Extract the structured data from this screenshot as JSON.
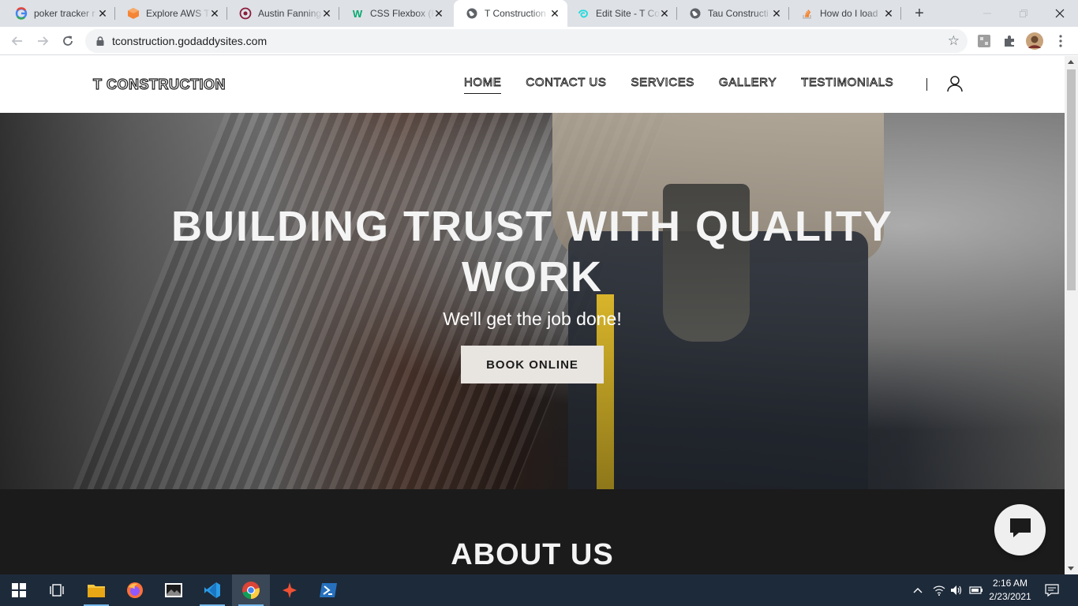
{
  "browser": {
    "tabs": [
      {
        "title": "poker tracker r",
        "icon": "google-icon",
        "active": false
      },
      {
        "title": "Explore AWS T",
        "icon": "aws-icon",
        "active": false
      },
      {
        "title": "Austin Fanning",
        "icon": "austin-site-icon",
        "active": false
      },
      {
        "title": "CSS Flexbox (F",
        "icon": "w3schools-icon",
        "active": false
      },
      {
        "title": "T Construction",
        "icon": "globe-icon",
        "active": true
      },
      {
        "title": "Edit Site - T Co",
        "icon": "godaddy-icon",
        "active": false
      },
      {
        "title": "Tau Constructi",
        "icon": "globe-icon",
        "active": false
      },
      {
        "title": "How do I load",
        "icon": "stackoverflow-icon",
        "active": false
      }
    ],
    "new_tab_label": "+",
    "url": "tconstruction.godaddysites.com"
  },
  "site": {
    "logo": "T CONSTRUCTION",
    "nav": [
      "HOME",
      "CONTACT US",
      "SERVICES",
      "GALLERY",
      "TESTIMONIALS"
    ],
    "current_nav": "HOME",
    "hero": {
      "title_line1": "BUILDING TRUST WITH QUALITY",
      "title_line2": "WORK",
      "subtitle": "We'll get the job done!",
      "cta": "BOOK ONLINE"
    },
    "about_title": "ABOUT US"
  },
  "taskbar": {
    "apps": [
      "start-icon",
      "task-view-icon",
      "file-explorer-icon",
      "firefox-icon",
      "photos-icon",
      "vscode-icon",
      "chrome-icon",
      "git-icon",
      "powershell-icon"
    ],
    "time": "2:16 AM",
    "date": "2/23/2021"
  },
  "colors": {
    "tabstrip": "#dee1e6",
    "page_dark": "#1b1b1b",
    "button_bg": "#e8e4e0",
    "taskbar": "#1d2a3a"
  }
}
